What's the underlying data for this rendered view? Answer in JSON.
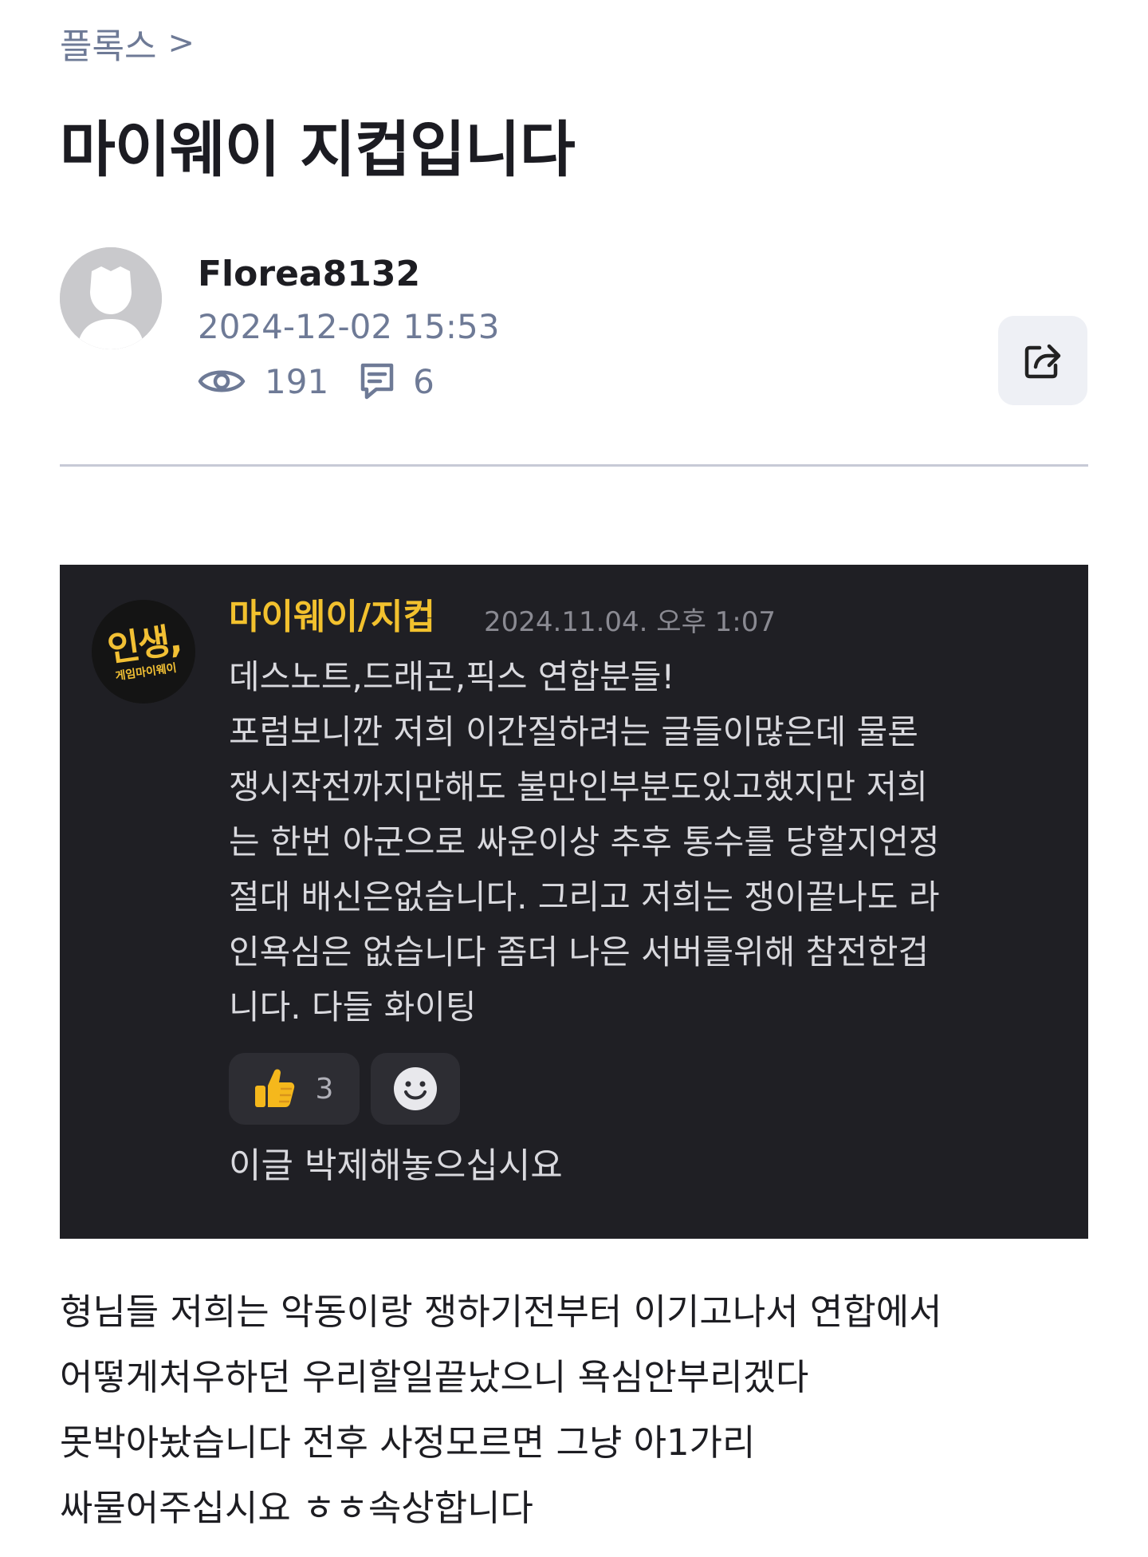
{
  "breadcrumb": {
    "category": "플록스",
    "separator": ">"
  },
  "post": {
    "title": "마이웨이 지컵입니다",
    "author": "Florea8132",
    "date": "2024-12-02 15:53",
    "views": "191",
    "comments": "6"
  },
  "icons": {
    "avatar": "default-user-avatar",
    "views": "eye-icon",
    "comments": "comment-icon",
    "share": "share-icon",
    "like": "thumbs-up-emoji",
    "emoji": "smiley-face-icon"
  },
  "embed": {
    "avatar_logo_main": "인생,",
    "avatar_logo_sub": "게임마이웨이",
    "name": "마이웨이/지컵",
    "time": "2024.11.04. 오후 1:07",
    "lines": [
      "데스노트,드래곤,픽스 연합분들!",
      "포럼보니깐 저희 이간질하려는 글들이많은데 물론",
      "쟁시작전까지만해도 불만인부분도있고했지만 저희",
      "는 한번 아군으로 싸운이상 추후 통수를 당할지언정",
      "절대 배신은없습니다. 그리고 저희는 쟁이끝나도 라",
      "인욕심은 없습니다 좀더 나은 서버를위해 참전한겁",
      "니다. 다들 화이팅"
    ],
    "like_count": "3",
    "comment": "이글 박제해놓으십시요"
  },
  "article": {
    "lines": [
      "형님들 저희는 악동이랑 쟁하기전부터 이기고나서 연합에서",
      "어떻게처우하던 우리할일끝났으니 욕심안부리겠다",
      "못박아놨습니다 전후 사정모르면 그냥 아1가리",
      "싸물어주십시요 ㅎㅎ속상합니다"
    ]
  },
  "colors": {
    "accent_gold": "#f2c12e",
    "meta_gray": "#6e7a96",
    "embed_bg": "#1f1f24"
  }
}
